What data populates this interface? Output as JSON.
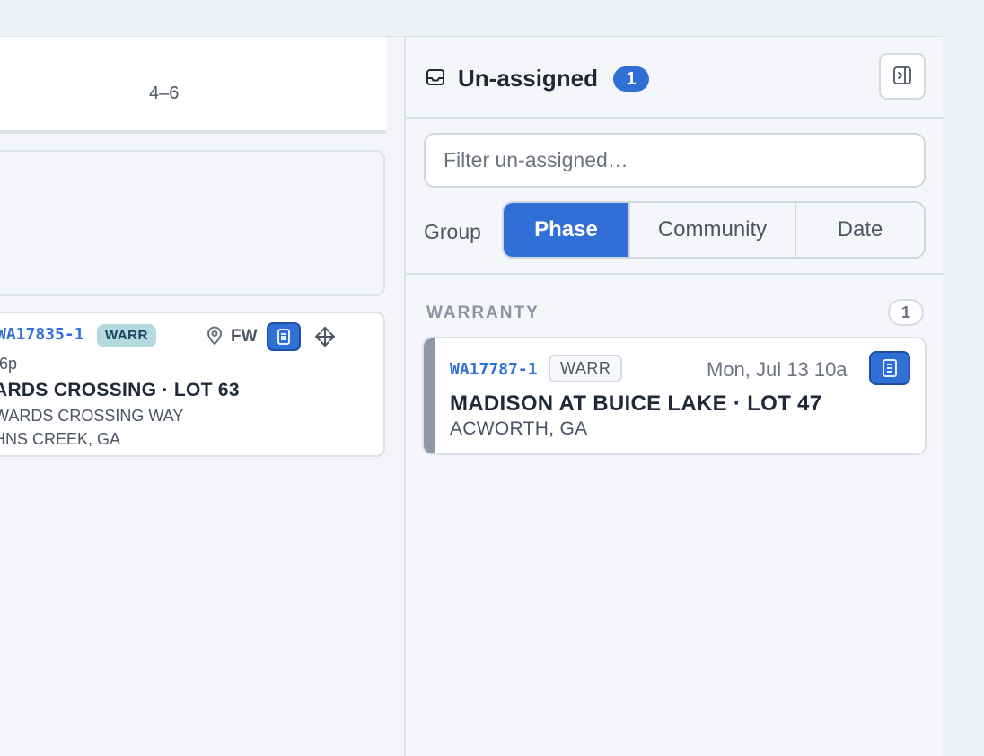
{
  "schedule": {
    "column_header": "4–6",
    "job_card": {
      "id": "WA17835-1",
      "badge": "WARR",
      "crew": "FW",
      "time": "-6p",
      "title": "ARDS CROSSING · LOT 63",
      "address_line1": "WARDS CROSSING WAY",
      "address_line2": "HNS CREEK, GA",
      "icons": [
        "map-pin-icon",
        "document-icon",
        "move-icon"
      ]
    }
  },
  "unassigned": {
    "title": "Un-assigned",
    "count": "1",
    "filter_placeholder": "Filter un-assigned…",
    "filter_value": "",
    "group_label": "Group",
    "group_options": [
      {
        "label": "Phase",
        "active": true
      },
      {
        "label": "Community",
        "active": false
      },
      {
        "label": "Date",
        "active": false
      }
    ],
    "groups": [
      {
        "heading": "WARRANTY",
        "count": "1",
        "items": [
          {
            "id": "WA17787-1",
            "badge": "WARR",
            "date": "Mon, Jul 13 10a",
            "title": "MADISON AT BUICE LAKE · LOT 47",
            "location": "ACWORTH, GA"
          }
        ]
      }
    ],
    "icons": [
      "inbox-icon",
      "collapse-panel-icon",
      "document-icon"
    ]
  },
  "colors": {
    "accent": "#2f6fd6",
    "warranty_badge_bg": "#b4d9de",
    "status_bar": "#8f99a6",
    "panel_bg": "#f4f6fa"
  }
}
